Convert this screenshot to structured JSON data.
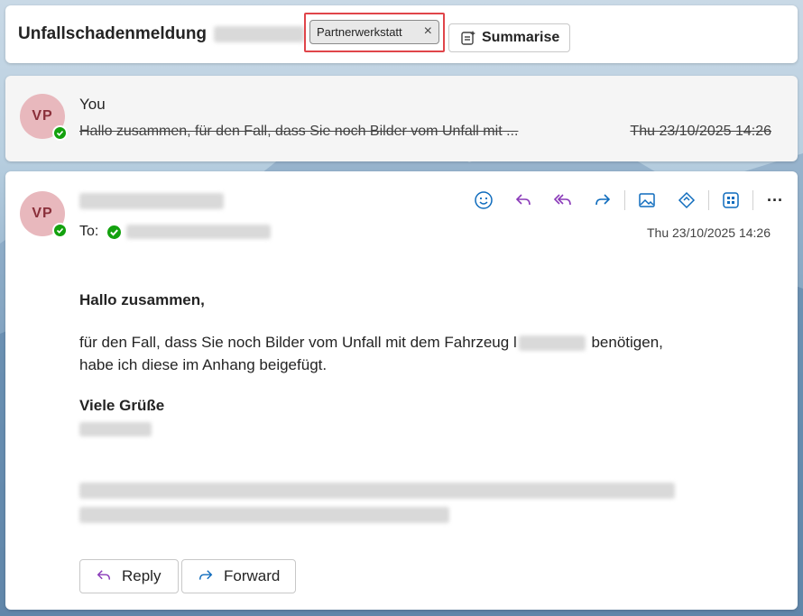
{
  "header": {
    "subject": "Unfallschadenmeldung",
    "category_tag": "Partnerwerkstatt",
    "tag_remove_symbol": "×",
    "summarise_label": "Summarise"
  },
  "collapsed_message": {
    "avatar_initials": "VP",
    "sender": "You",
    "preview": "Hallo zusammen, für den Fall, dass Sie noch Bilder vom Unfall mit ...",
    "date": "Thu 23/10/2025 14:26"
  },
  "message": {
    "avatar_initials": "VP",
    "to_label": "To:",
    "date": "Thu 23/10/2025 14:26",
    "greeting": "Hallo zusammen,",
    "line1_before": "für den Fall, dass Sie noch Bilder vom Unfall mit dem Fahrzeug",
    "line1_prefix": "l",
    "line1_after": "benötigen,",
    "line2": "habe ich diese im Anhang beigefügt.",
    "closing": "Viele Grüße",
    "toolbar_icons": [
      "emoji-icon",
      "reply-icon",
      "reply-all-icon",
      "forward-icon",
      "image-icon",
      "immersive-reader-icon",
      "apps-icon",
      "more-icon"
    ],
    "more_symbol": "···",
    "reply_label": "Reply",
    "forward_label": "Forward"
  },
  "colors": {
    "accent": "#0f6cbd",
    "reply_purple": "#8a3ab9",
    "presence_green": "#13a10e",
    "avatar_bg": "#e8b8bd",
    "avatar_text": "#8a2f3a",
    "tag_highlight": "#e0454a"
  }
}
